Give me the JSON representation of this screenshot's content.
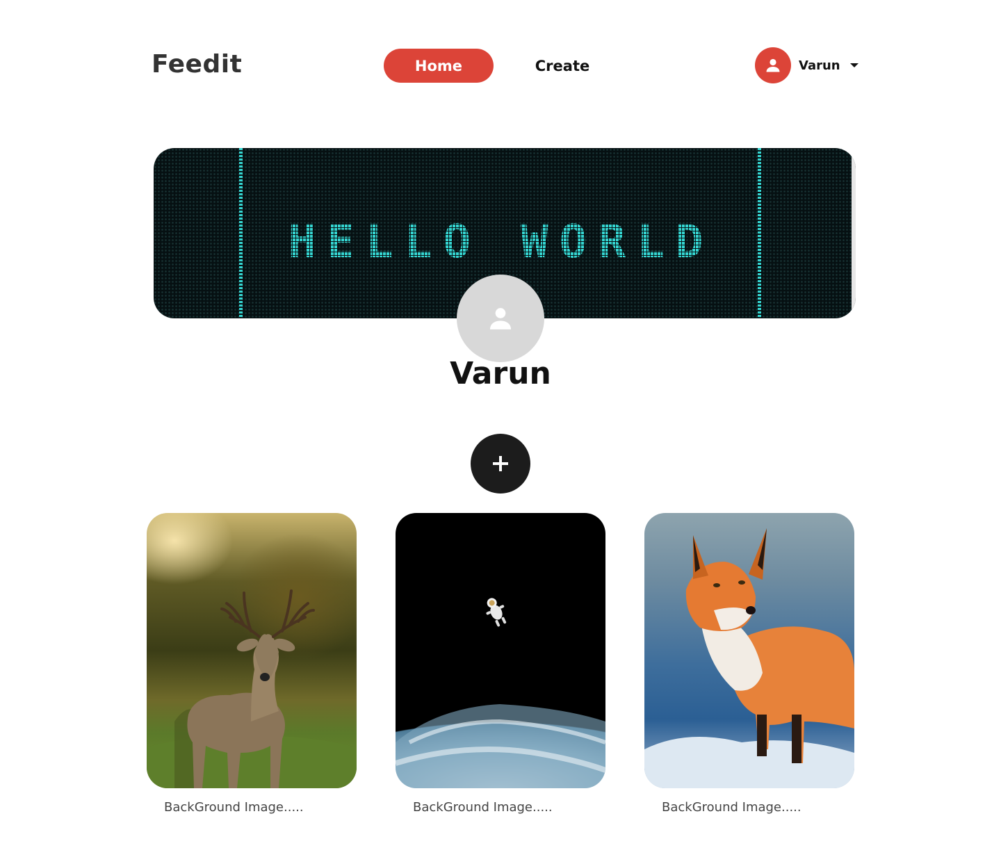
{
  "header": {
    "logo": "Feedit",
    "nav": {
      "home": "Home",
      "create": "Create"
    },
    "user": {
      "name": "Varun",
      "avatar_icon": "user-icon"
    }
  },
  "banner": {
    "text": "HELLO WORLD",
    "accent": "#35d6d2"
  },
  "profile": {
    "name": "Varun",
    "avatar_icon": "user-icon"
  },
  "add_button": {
    "label": "+"
  },
  "posts": [
    {
      "caption": "BackGround Image.....",
      "subject": "deer"
    },
    {
      "caption": "BackGround Image.....",
      "subject": "astronaut-over-earth"
    },
    {
      "caption": "BackGround Image.....",
      "subject": "fox"
    }
  ],
  "colors": {
    "accent": "#dc4438",
    "dark": "#1c1c1c",
    "avatar_bg": "#d8d8d8"
  }
}
